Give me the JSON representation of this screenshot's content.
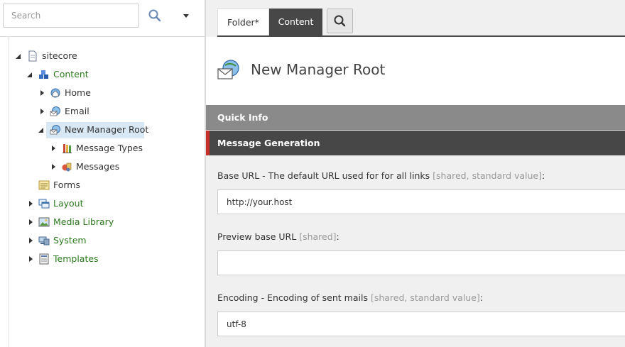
{
  "search": {
    "placeholder": "Search"
  },
  "tree": {
    "sitecore": "sitecore",
    "content": "Content",
    "home": "Home",
    "email": "Email",
    "new_manager_root": "New Manager Root",
    "message_types": "Message Types",
    "messages": "Messages",
    "forms": "Forms",
    "layout": "Layout",
    "media_library": "Media Library",
    "system": "System",
    "templates": "Templates"
  },
  "tabs": {
    "folder": "Folder*",
    "content": "Content"
  },
  "item": {
    "title": "New Manager Root"
  },
  "sections": {
    "quick_info": "Quick Info",
    "message_generation": "Message Generation"
  },
  "fields": {
    "base_url": {
      "label": "Base URL - The default URL used for for all links ",
      "meta": "[shared, standard value]",
      "suffix": ":",
      "value": "http://your.host"
    },
    "preview_base_url": {
      "label": "Preview base URL ",
      "meta": "[shared]",
      "suffix": ":",
      "value": ""
    },
    "encoding": {
      "label": "Encoding - Encoding of sent mails ",
      "meta": "[shared, standard value]",
      "suffix": ":",
      "value": "utf-8"
    }
  },
  "colors": {
    "accent_red": "#c8312b",
    "tree_green": "#2c7a1e",
    "tab_dark": "#474747",
    "selection": "#d8e8f5"
  }
}
